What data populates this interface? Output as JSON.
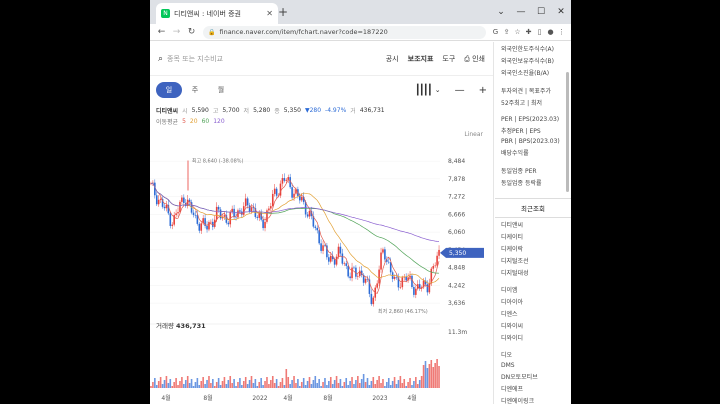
{
  "browser": {
    "tab_title": "디티앤씨 : 네이버 증권",
    "tab_favicon": "N",
    "url": "finance.naver.com/item/fchart.naver?code=187220"
  },
  "toolbar": {
    "search_placeholder": "종목 또는 지수비교",
    "actions": [
      "공시",
      "보조지표",
      "도구",
      "인쇄"
    ]
  },
  "periods": [
    "일",
    "주",
    "월"
  ],
  "selected_period": "일",
  "quote": {
    "name": "디티앤씨",
    "open_label": "시",
    "open": "5,590",
    "high_label": "고",
    "high": "5,700",
    "low_label": "저",
    "low": "5,280",
    "close_label": "종",
    "close": "5,350",
    "change": "▼280",
    "change_pct": "-4.97%",
    "volume_label": "거",
    "volume": "436,731"
  },
  "moving_avg": {
    "label": "이동평균",
    "periods": [
      "5",
      "20",
      "60",
      "120"
    ]
  },
  "scale_mode": "Linear",
  "volume_label": "거래량",
  "volume_value": "436,731",
  "colors": {
    "up": "#e8403a",
    "down": "#2c6bd6",
    "accent": "#3e63bf",
    "ma5": "#e05a4e",
    "ma20": "#e2a033",
    "ma60": "#53a45a",
    "ma120": "#8a5fd0"
  },
  "chart_data": {
    "type": "candlestick",
    "y_ticks": [
      "8,484",
      "7,878",
      "7,272",
      "6,666",
      "6,060",
      "5,454",
      "4,848",
      "4,242",
      "3,636"
    ],
    "y_range": [
      3400,
      9000
    ],
    "x_ticks": [
      "4월",
      "8월",
      "2022",
      "4월",
      "8월",
      "2023",
      "4월"
    ],
    "last_price": "5,350",
    "max_annotation": "최고 8,640 (-38.08%)",
    "min_annotation": "최저 2,860 (46.17%)",
    "volume_max_label": "11.3m",
    "approx_close_path": [
      {
        "x": "2021-03",
        "y": 7600
      },
      {
        "x": "2021-04",
        "y": 7000
      },
      {
        "x": "2021-05",
        "y": 6400
      },
      {
        "x": "2021-06",
        "y": 7300
      },
      {
        "x": "2021-07",
        "y": 6500
      },
      {
        "x": "2021-08",
        "y": 6200
      },
      {
        "x": "2021-09",
        "y": 6700
      },
      {
        "x": "2021-10",
        "y": 6500
      },
      {
        "x": "2021-11",
        "y": 6800
      },
      {
        "x": "2021-12",
        "y": 7000
      },
      {
        "x": "2022-01",
        "y": 6300
      },
      {
        "x": "2022-02",
        "y": 7200
      },
      {
        "x": "2022-03",
        "y": 7900
      },
      {
        "x": "2022-04",
        "y": 7400
      },
      {
        "x": "2022-05",
        "y": 6900
      },
      {
        "x": "2022-06",
        "y": 6000
      },
      {
        "x": "2022-07",
        "y": 5100
      },
      {
        "x": "2022-08",
        "y": 5300
      },
      {
        "x": "2022-09",
        "y": 4600
      },
      {
        "x": "2022-10",
        "y": 4700
      },
      {
        "x": "2022-11",
        "y": 3700
      },
      {
        "x": "2022-12",
        "y": 5500
      },
      {
        "x": "2023-01",
        "y": 4300
      },
      {
        "x": "2023-02",
        "y": 4500
      },
      {
        "x": "2023-03",
        "y": 4100
      },
      {
        "x": "2023-04",
        "y": 4300
      },
      {
        "x": "2023-05",
        "y": 5350
      }
    ]
  },
  "sidebar": {
    "top_items": [
      "외국인한도주식수(A)",
      "외국인보유주식수(B)",
      "외국인소진율(B/A)"
    ],
    "mid_items": [
      "투자의견 | 목표주가",
      "52주최고 | 최저"
    ],
    "per_items": [
      "PER | EPS(2023.03)",
      "추정PER | EPS",
      "PBR | BPS(2023.03)",
      "배당수익률"
    ],
    "industry_items": [
      "동일업종 PER",
      "동일업종 등락률"
    ],
    "recent_header": "최근조회",
    "recent_items": [
      "디티앤씨",
      "디케이티",
      "디케이락",
      "디지털조선",
      "디지털대성",
      "",
      "디이엠",
      "디아이아",
      "디엔스",
      "디와이씨",
      "디와이디",
      "",
      "디오",
      "DMS",
      "DN오토모티브",
      "디엔에프",
      "디엔에이링크"
    ]
  }
}
